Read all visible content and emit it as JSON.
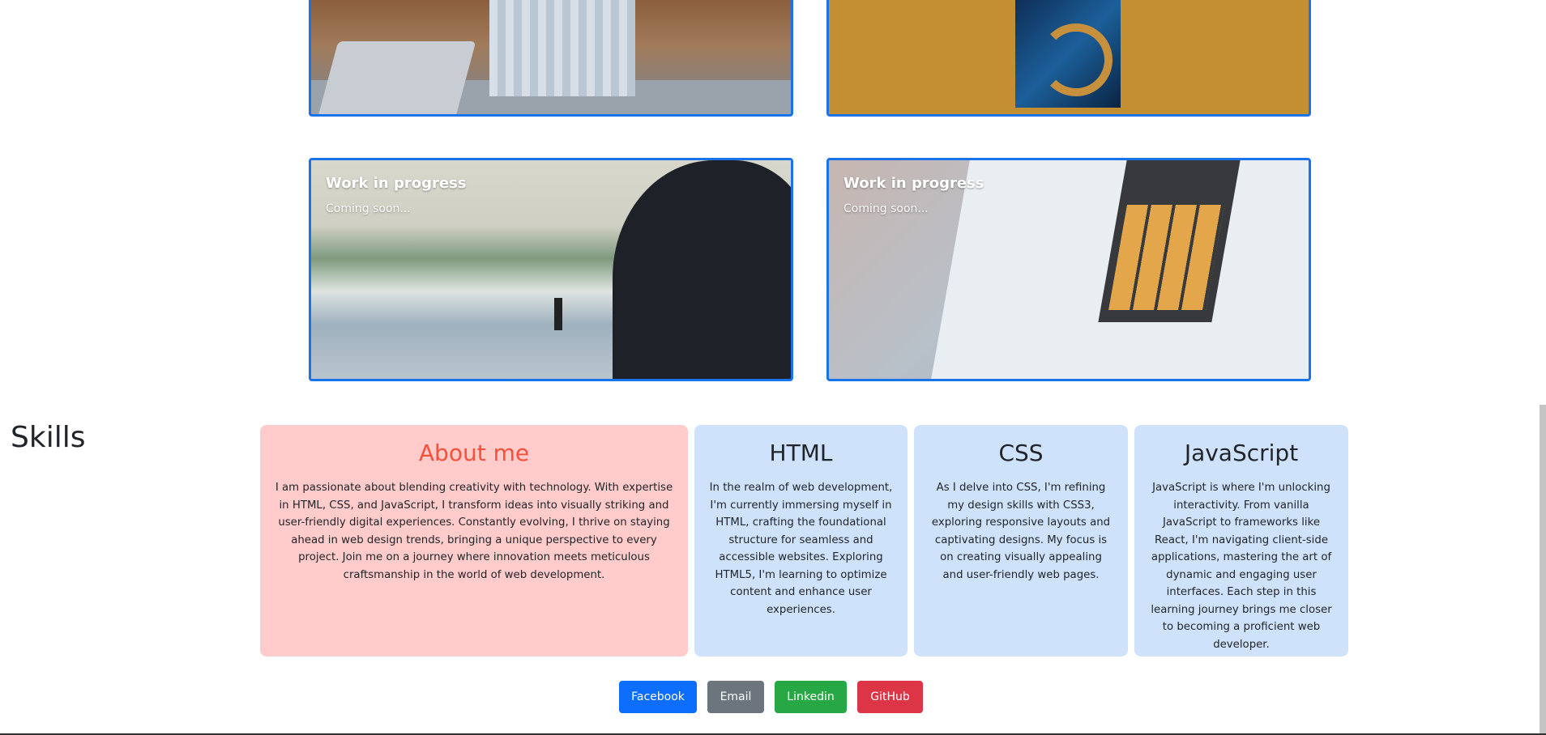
{
  "projects": [
    {
      "title": "",
      "subtitle": ""
    },
    {
      "title": "",
      "subtitle": ""
    },
    {
      "title": "Work in progress",
      "subtitle": "Coming soon..."
    },
    {
      "title": "Work in progress",
      "subtitle": "Coming soon..."
    }
  ],
  "skills": {
    "heading": "Skills",
    "about": {
      "title": "About me",
      "text": "I am passionate about blending creativity with technology. With expertise in HTML, CSS, and JavaScript, I transform ideas into visually striking and user-friendly digital experiences. Constantly evolving, I thrive on staying ahead in web design trends, bringing a unique perspective to every project. Join me on a journey where innovation meets meticulous craftsmanship in the world of web development."
    },
    "html": {
      "title": "HTML",
      "text": "In the realm of web development, I'm currently immersing myself in HTML, crafting the foundational structure for seamless and accessible websites. Exploring HTML5, I'm learning to optimize content and enhance user experiences."
    },
    "css": {
      "title": "CSS",
      "text": "As I delve into CSS, I'm refining my design skills with CSS3, exploring responsive layouts and captivating designs. My focus is on creating visually appealing and user-friendly web pages."
    },
    "js": {
      "title": "JavaScript",
      "text": "JavaScript is where I'm unlocking interactivity. From vanilla JavaScript to frameworks like React, I'm navigating client-side applications, mastering the art of dynamic and engaging user interfaces. Each step in this learning journey brings me closer to becoming a proficient web developer."
    }
  },
  "buttons": {
    "facebook": "Facebook",
    "email": "Email",
    "linkedin": "Linkedin",
    "github": "GitHub"
  },
  "colors": {
    "card_border": "#1a73e8",
    "about_bg": "#ffcbcb",
    "about_title": "#f4503a",
    "skill_bg": "#cfe2fc",
    "facebook": "#0d6efd",
    "email": "#6c757d",
    "linkedin": "#28a745",
    "github": "#dc3545"
  }
}
